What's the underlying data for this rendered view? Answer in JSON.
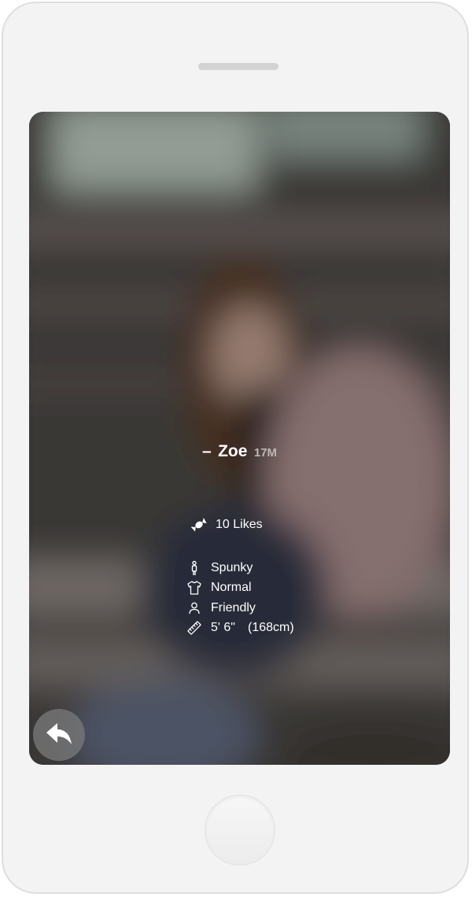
{
  "profile": {
    "dash": "–",
    "name": "Zoe",
    "age": "17M",
    "likes": "10 Likes",
    "personality": "Spunky",
    "style": "Normal",
    "attitude": "Friendly",
    "height_ft": "5' 6\"",
    "height_cm": "(168cm)"
  },
  "icons": {
    "likes": "candy-icon",
    "personality": "person-figure-icon",
    "style": "tshirt-icon",
    "attitude": "user-icon",
    "height": "ruler-icon",
    "back": "back-arrow-icon"
  },
  "colors": {
    "phone_body": "#f3f3f3",
    "text": "#ffffff",
    "age_text": "#bdb7b5",
    "back_button_bg": "#787878"
  }
}
